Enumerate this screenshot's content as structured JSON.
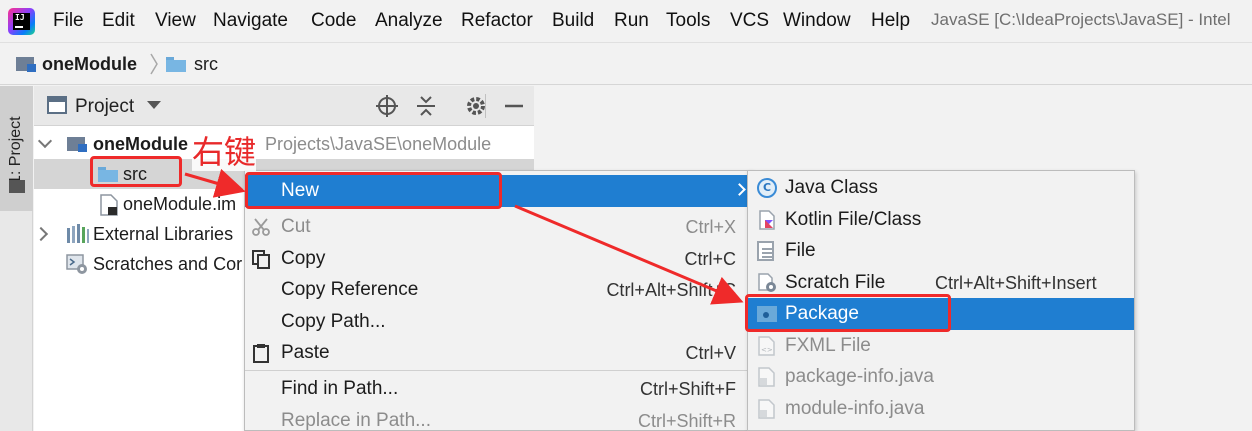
{
  "menu_bar": {
    "items": [
      "File",
      "Edit",
      "View",
      "Navigate",
      "Code",
      "Analyze",
      "Refactor",
      "Build",
      "Run",
      "Tools",
      "VCS",
      "Window",
      "Help"
    ],
    "window_title": "JavaSE [C:\\IdeaProjects\\JavaSE] - Intel"
  },
  "breadcrumb": {
    "module": "oneModule",
    "folder": "src"
  },
  "tool_window_strip": {
    "project_tab_label": "1: Project"
  },
  "project_panel": {
    "title": "Project",
    "tree": {
      "root_name": "oneModule",
      "root_path": "C:\\IdeaProjects\\JavaSE\\oneModule",
      "root_path_visible": "Projects\\JavaSE\\oneModule",
      "src": "src",
      "iml_file": "oneModule.im",
      "external_libraries": "External Libraries",
      "scratches": "Scratches and Cor"
    }
  },
  "context_menu": {
    "new_label": "New",
    "items": [
      {
        "label": "Cut",
        "shortcut": "Ctrl+X",
        "enabled": false
      },
      {
        "label": "Copy",
        "shortcut": "Ctrl+C",
        "enabled": true
      },
      {
        "label": "Copy Reference",
        "shortcut": "Ctrl+Alt+Shift+C",
        "enabled": true
      },
      {
        "label": "Copy Path...",
        "shortcut": "",
        "enabled": true
      },
      {
        "label": "Paste",
        "shortcut": "Ctrl+V",
        "enabled": true
      },
      {
        "label": "Find in Path...",
        "shortcut": "Ctrl+Shift+F",
        "enabled": true
      },
      {
        "label": "Replace in Path...",
        "shortcut": "Ctrl+Shift+R",
        "enabled": false
      }
    ]
  },
  "new_submenu": {
    "items": [
      {
        "label": "Java Class",
        "shortcut": "",
        "icon": "java-class-icon",
        "enabled": true
      },
      {
        "label": "Kotlin File/Class",
        "shortcut": "",
        "icon": "kotlin-file-icon",
        "enabled": true
      },
      {
        "label": "File",
        "shortcut": "",
        "icon": "file-icon",
        "enabled": true
      },
      {
        "label": "Scratch File",
        "shortcut": "Ctrl+Alt+Shift+Insert",
        "icon": "scratch-file-icon",
        "enabled": true
      },
      {
        "label": "Package",
        "shortcut": "",
        "icon": "package-icon",
        "enabled": true,
        "selected": true
      },
      {
        "label": "FXML File",
        "shortcut": "",
        "icon": "fxml-file-icon",
        "enabled": false
      },
      {
        "label": "package-info.java",
        "shortcut": "",
        "icon": "java-file-icon",
        "enabled": false
      },
      {
        "label": "module-info.java",
        "shortcut": "",
        "icon": "java-file-icon",
        "enabled": false
      }
    ]
  },
  "annotation": {
    "text": "右键",
    "color": "#e8292a"
  },
  "colors": {
    "selection_blue": "#1f7ed1",
    "annotation_red": "#ef2a2a",
    "folder_blue": "#78b6e3"
  }
}
